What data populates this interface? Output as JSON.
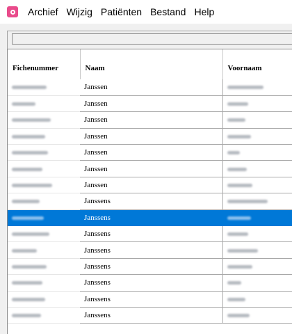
{
  "app": {
    "icon": "app-logo-icon",
    "accent_color": "#e94b8b"
  },
  "menu": {
    "items": [
      {
        "label": "Archief"
      },
      {
        "label": "Wijzig"
      },
      {
        "label": "Patiënten"
      },
      {
        "label": "Bestand"
      },
      {
        "label": "Help"
      }
    ]
  },
  "table": {
    "headers": {
      "fichenummer": "Fichenummer",
      "naam": "Naam",
      "voornaam": "Voornaam"
    },
    "selection_color": "#0078d7",
    "rows": [
      {
        "naam": "Janssen",
        "selected": false
      },
      {
        "naam": "Janssen",
        "selected": false
      },
      {
        "naam": "Janssen",
        "selected": false
      },
      {
        "naam": "Janssen",
        "selected": false
      },
      {
        "naam": "Janssen",
        "selected": false
      },
      {
        "naam": "Janssen",
        "selected": false
      },
      {
        "naam": "Janssen",
        "selected": false
      },
      {
        "naam": "Janssens",
        "selected": false
      },
      {
        "naam": "Janssens",
        "selected": true
      },
      {
        "naam": "Janssens",
        "selected": false
      },
      {
        "naam": "Janssens",
        "selected": false
      },
      {
        "naam": "Janssens",
        "selected": false
      },
      {
        "naam": "Janssens",
        "selected": false
      },
      {
        "naam": "Janssens",
        "selected": false
      },
      {
        "naam": "Janssens",
        "selected": false
      }
    ]
  }
}
